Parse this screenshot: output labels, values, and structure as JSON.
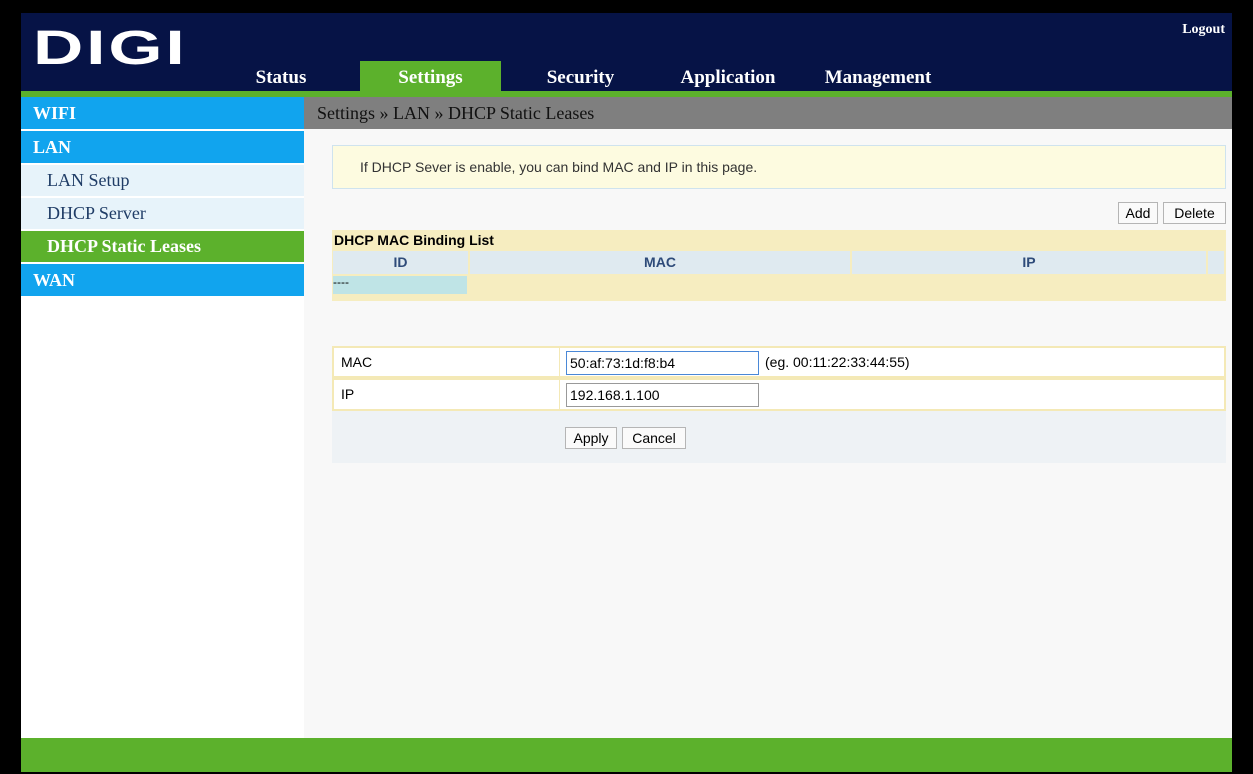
{
  "header": {
    "logo": "DIGI",
    "logout": "Logout",
    "nav": {
      "status": "Status",
      "settings": "Settings",
      "security": "Security",
      "application": "Application",
      "management": "Management"
    }
  },
  "sidebar": {
    "wifi": "WIFI",
    "lan": "LAN",
    "lan_setup": "LAN Setup",
    "dhcp_server": "DHCP Server",
    "dhcp_static_leases": "DHCP Static Leases",
    "wan": "WAN"
  },
  "breadcrumb": "Settings » LAN » DHCP Static Leases",
  "notice": "If DHCP Sever is enable, you can bind MAC and IP in this page.",
  "buttons": {
    "add": "Add",
    "delete": "Delete",
    "apply": "Apply",
    "cancel": "Cancel"
  },
  "binding_list": {
    "title": "DHCP MAC Binding List",
    "columns": [
      "ID",
      "MAC",
      "IP"
    ],
    "empty_row": "----"
  },
  "form": {
    "mac_label": "MAC",
    "mac_value": "50:af:73:1d:f8:b4",
    "mac_hint": "(eg. 00:11:22:33:44:55)",
    "ip_label": "IP",
    "ip_value": "192.168.1.100"
  },
  "colors": {
    "header_bg": "#061346",
    "accent_green": "#5cb12c",
    "menu_blue": "#11a4ee"
  }
}
